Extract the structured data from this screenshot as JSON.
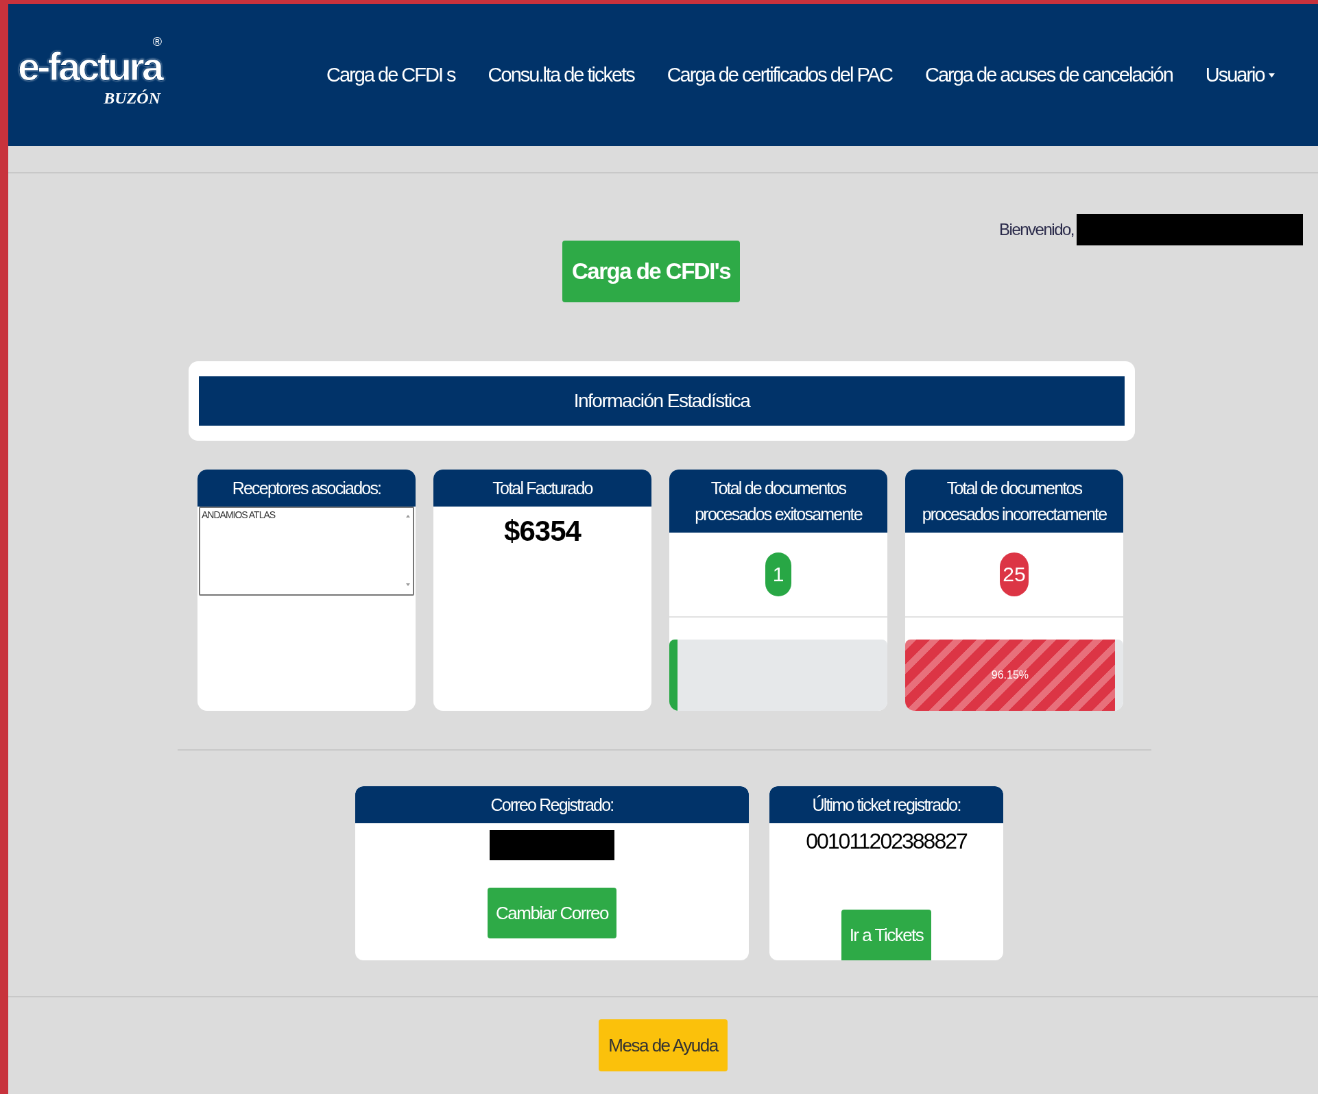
{
  "brand": {
    "name": "e-factura",
    "sub": "BUZÓN",
    "mark": "®"
  },
  "nav": [
    {
      "label": "Carga de CFDI s",
      "kind": "link"
    },
    {
      "label": "Consu.lta de tickets",
      "kind": "link"
    },
    {
      "label": "Carga de certificados del PAC",
      "kind": "link"
    },
    {
      "label": "Carga de acuses de cancelación",
      "kind": "link"
    },
    {
      "label": "Usuario",
      "kind": "dropdown"
    }
  ],
  "welcome": {
    "label": "Bienvenido,",
    "name_redacted": true
  },
  "main_button": "Carga de CFDI's",
  "stats_title": "Información Estadística",
  "cards": [
    {
      "kind": "list",
      "title": "Receptores asociados:",
      "items": [
        "ANDAMIOS ATLAS"
      ]
    },
    {
      "kind": "amount",
      "title": "Total Facturado",
      "value": "$6354"
    },
    {
      "kind": "count",
      "title": "Total de documentos procesados exitosamente",
      "value": "1",
      "color": "#28a745",
      "progress": {
        "level": 0.0385,
        "striped": false
      }
    },
    {
      "kind": "count",
      "title": "Total de documentos procesados incorrectamente",
      "value": "25",
      "color": "#dc3545",
      "progress": {
        "level": 0.9615,
        "label": "96.15%",
        "striped": true
      }
    }
  ],
  "email_card": {
    "title": "Correo Registrado:",
    "email_redacted": true,
    "button": "Cambiar Correo"
  },
  "ticket_card": {
    "title": "Último ticket registrado:",
    "value": "001011202388827",
    "button": "Ir a Tickets"
  },
  "help_button": "Mesa de Ayuda"
}
